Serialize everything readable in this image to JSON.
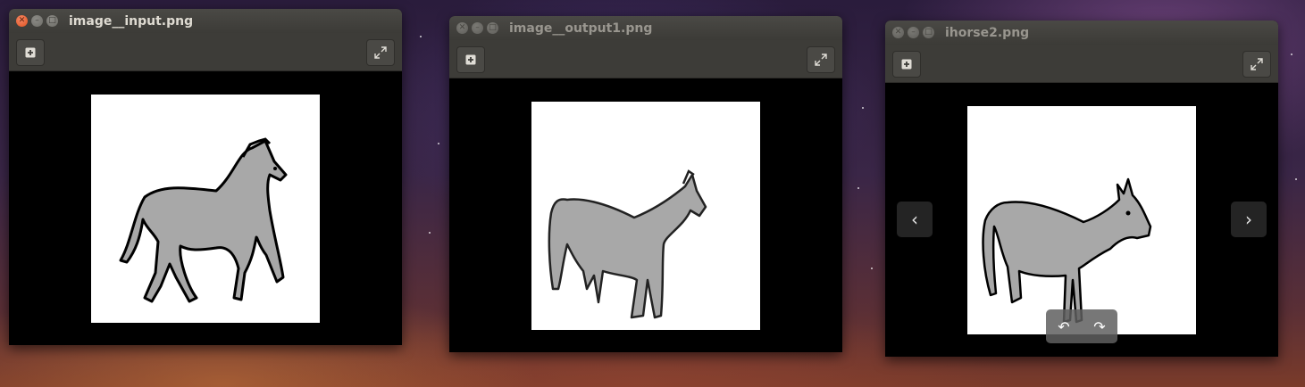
{
  "windows": [
    {
      "title": "image__input.png",
      "active": true
    },
    {
      "title": "image__output1.png",
      "active": false
    },
    {
      "title": "ihorse2.png",
      "active": false
    }
  ],
  "icons": {
    "close": "close-icon",
    "minimize": "minimize-icon",
    "maximize": "maximize-icon",
    "add": "plus-icon",
    "fullscreen": "fullscreen-icon",
    "prev": "chevron-left-icon",
    "next": "chevron-right-icon",
    "rotate_left": "rotate-left-icon",
    "rotate_right": "rotate-right-icon"
  },
  "colors": {
    "titlebar": "#3c3b37",
    "close_button": "#e0521f",
    "horse_fill": "#a8a8a8",
    "background_black": "#000000"
  }
}
